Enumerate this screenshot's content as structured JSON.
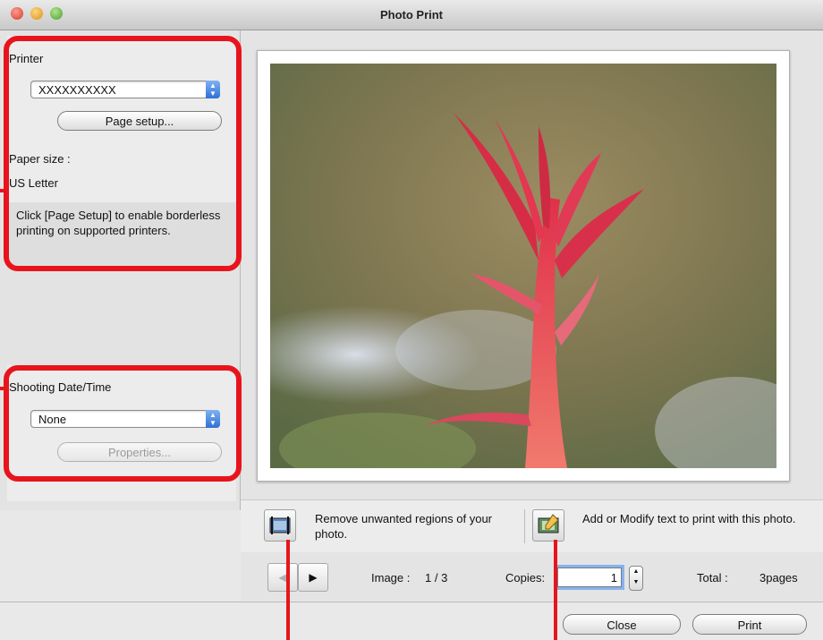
{
  "window": {
    "title": "Photo Print"
  },
  "printer": {
    "label": "Printer",
    "selected": "XXXXXXXXXX",
    "page_setup": "Page setup...",
    "paper_size_label": "Paper size :",
    "paper_size_value": "US Letter",
    "note": "Click [Page Setup] to enable borderless printing on supported printers."
  },
  "shooting": {
    "label": "Shooting Date/Time",
    "selected": "None",
    "properties": "Properties..."
  },
  "tools": {
    "trim_text": "Remove unwanted regions of your photo.",
    "text_text": "Add or Modify text to print with this photo."
  },
  "nav": {
    "image_label": "Image :",
    "image_value": "1 / 3",
    "copies_label": "Copies:",
    "copies_value": "1",
    "total_label": "Total :",
    "total_value": "3pages"
  },
  "buttons": {
    "close": "Close",
    "print": "Print"
  },
  "colors": {
    "annotation": "#e8141d",
    "focus": "#86b3ee"
  }
}
